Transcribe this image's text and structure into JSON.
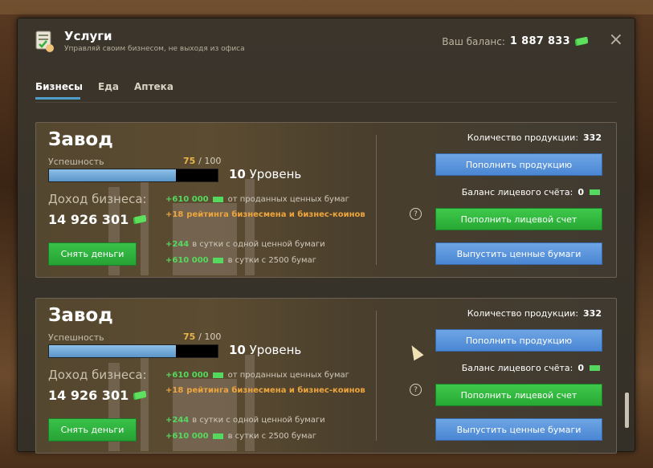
{
  "window": {
    "title": "Услуги",
    "subtitle": "Управляй своим бизнесом, не выходя из офиса",
    "balance_label": "Ваш баланс:",
    "balance_value": "1 887 833",
    "close_icon": "×"
  },
  "tabs": [
    {
      "label": "Бизнесы",
      "active": true
    },
    {
      "label": "Еда",
      "active": false
    },
    {
      "label": "Аптека",
      "active": false
    }
  ],
  "colors": {
    "accent_blue": "#4f9ec9",
    "green": "#55d85e",
    "orange": "#eea53c",
    "gold": "#e8b64a"
  },
  "cards": [
    {
      "title": "Завод",
      "success_label": "Успешность",
      "progress_value": "75",
      "progress_total": "/ 100",
      "progress_fraction": 0.75,
      "level_number": "10",
      "level_word": "Уровень",
      "income_label": "Доход бизнеса:",
      "income_value": "14 926 301",
      "line1_value": "+610 000",
      "line1_text": "от проданных ценных бумаг",
      "line2_value": "+18",
      "line2_text": "рейтинга бизнесмена и бизнес-коинов",
      "line3_value": "+244",
      "line3_text": "в сутки с одной ценной бумаги",
      "line4_value": "+610 000",
      "line4_text": "в сутки с 2500 бумаг",
      "withdraw_button": "Снять деньги",
      "products_label": "Количество продукции:",
      "products_value": "332",
      "refill_products_button": "Пополнить продукцию",
      "account_balance_label": "Баланс лицевого счёта:",
      "account_balance_value": "0",
      "help_icon": "?",
      "refill_account_button": "Пополнить лицевой счет",
      "issue_securities_button": "Выпустить ценные бумаги"
    },
    {
      "title": "Завод",
      "success_label": "Успешность",
      "progress_value": "75",
      "progress_total": "/ 100",
      "progress_fraction": 0.75,
      "level_number": "10",
      "level_word": "Уровень",
      "income_label": "Доход бизнеса:",
      "income_value": "14 926 301",
      "line1_value": "+610 000",
      "line1_text": "от проданных ценных бумаг",
      "line2_value": "+18",
      "line2_text": "рейтинга бизнесмена и бизнес-коинов",
      "line3_value": "+244",
      "line3_text": "в сутки с одной ценной бумаги",
      "line4_value": "+610 000",
      "line4_text": "в сутки с 2500 бумаг",
      "withdraw_button": "Снять деньги",
      "products_label": "Количество продукции:",
      "products_value": "332",
      "refill_products_button": "Пополнить продукцию",
      "account_balance_label": "Баланс лицевого счёта:",
      "account_balance_value": "0",
      "help_icon": "?",
      "refill_account_button": "Пополнить лицевой счет",
      "issue_securities_button": "Выпустить ценные бумаги"
    }
  ]
}
